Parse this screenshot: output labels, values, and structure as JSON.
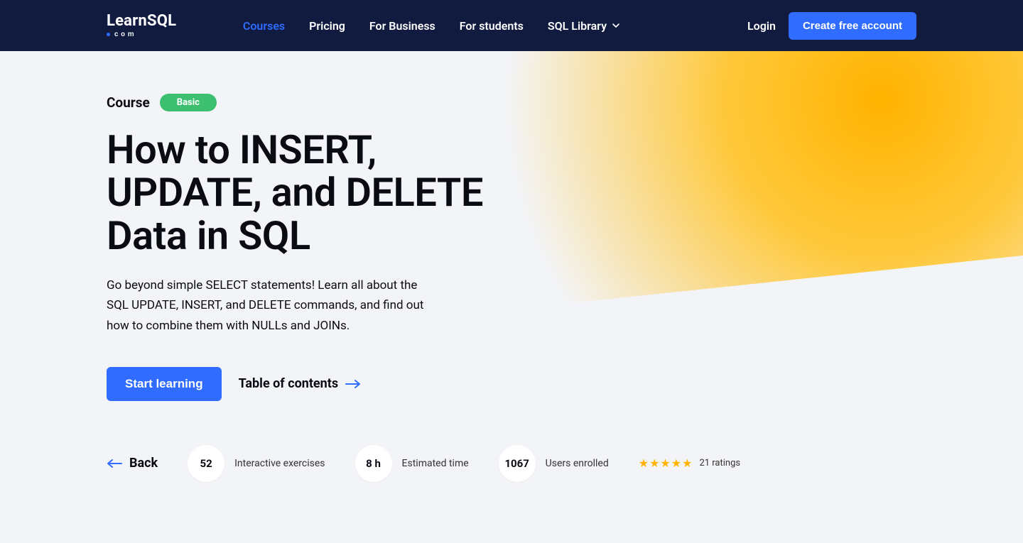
{
  "header": {
    "logo": {
      "part1": "Learn",
      "part2": "SQL",
      "suffix": "com"
    },
    "nav": [
      {
        "label": "Courses",
        "active": true
      },
      {
        "label": "Pricing",
        "active": false
      },
      {
        "label": "For Business",
        "active": false
      },
      {
        "label": "For students",
        "active": false
      },
      {
        "label": "SQL Library",
        "active": false,
        "dropdown": true
      }
    ],
    "login": "Login",
    "create_account": "Create free account"
  },
  "page": {
    "course_label": "Course",
    "badge": "Basic",
    "title": "How to INSERT, UPDATE, and DELETE Data in SQL",
    "description": "Go beyond simple SELECT statements! Learn all about the SQL UPDATE, INSERT, and DELETE commands, and find out how to combine them with NULLs and JOINs.",
    "start_btn": "Start learning",
    "toc": "Table of contents",
    "back": "Back"
  },
  "stats": [
    {
      "value": "52",
      "label": "Interactive exercises"
    },
    {
      "value": "8 h",
      "label": "Estimated time"
    },
    {
      "value": "1067",
      "label": "Users enrolled"
    }
  ],
  "rating": {
    "stars": 5,
    "text": "21 ratings"
  }
}
